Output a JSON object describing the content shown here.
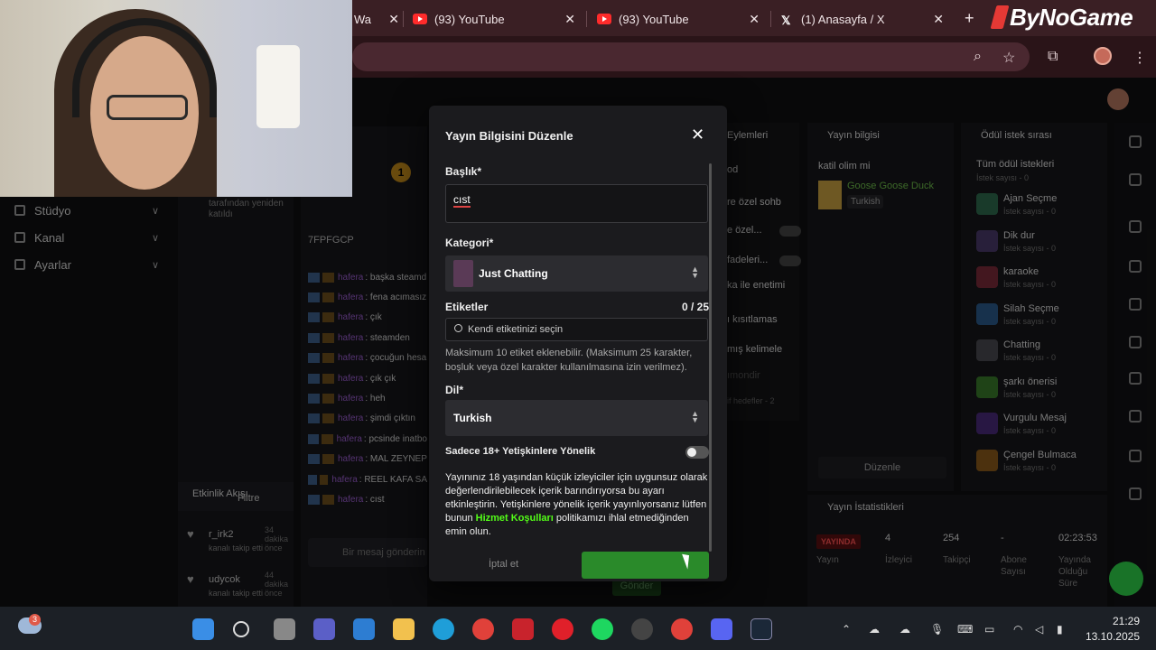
{
  "browser": {
    "tabs": [
      {
        "label": "Wa",
        "type": "partial"
      },
      {
        "label": "(93) YouTube",
        "type": "youtube"
      },
      {
        "label": "(93) YouTube",
        "type": "youtube"
      },
      {
        "label": "(1) Anasayfa / X",
        "type": "x"
      }
    ],
    "brand": "ByNoGame"
  },
  "leftnav": {
    "items": [
      {
        "label": "Stüdyo",
        "icon": "studio-icon"
      },
      {
        "label": "Kanal",
        "icon": "channel-icon"
      },
      {
        "label": "Ayarlar",
        "icon": "gear-icon"
      }
    ]
  },
  "activity": {
    "header": "Etkinlik Akışı",
    "filter": "Filtre",
    "top_text": "tarafından yeniden katıldı",
    "follows": [
      {
        "name": "r_irk2",
        "ago": "34 dakika önce",
        "sub": "kanalı takip etti"
      },
      {
        "name": "udycok",
        "ago": "44 dakika önce",
        "sub": "kanalı takip etti"
      }
    ]
  },
  "chat": {
    "badge": "1",
    "code": "7FPFGCP",
    "lines": [
      {
        "user": "hafera",
        "msg": "başka steamd"
      },
      {
        "user": "hafera",
        "msg": "fena acımasız"
      },
      {
        "user": "hafera",
        "msg": "çık"
      },
      {
        "user": "hafera",
        "msg": "steamden"
      },
      {
        "user": "hafera",
        "msg": "çocuğun hesa"
      },
      {
        "user": "hafera",
        "msg": "çık çık"
      },
      {
        "user": "hafera",
        "msg": "heh"
      },
      {
        "user": "hafera",
        "msg": "şimdi çıktın"
      },
      {
        "user": "hafera",
        "msg": "pcsinde inatbo"
      },
      {
        "user": "hafera",
        "msg": "MAL ZEYNEP"
      },
      {
        "user": "hafera",
        "msg": "REEL KAFA SA"
      },
      {
        "user": "hafera",
        "msg": "cıst"
      }
    ],
    "input_placeholder": "Bir mesaj gönderin",
    "send": "Gönder"
  },
  "mod": {
    "title": "Eylemleri",
    "items": [
      "od",
      "re özel sohb",
      "e özel...",
      "fadeleri...",
      "ka ile enetimi",
      "ı kısıtlamas",
      "mış kelimele",
      "ımondir",
      "if hedefler - 2"
    ]
  },
  "stream_info": {
    "title": "Yayın bilgisi",
    "stream_title": "katil olim mi",
    "game": "Goose Goose Duck",
    "language": "Turkish",
    "edit": "Düzenle"
  },
  "rewards": {
    "title": "Ödül istek sırası",
    "all": "Tüm ödül istekleri",
    "all_sub": "İstek sayısı - 0",
    "items": [
      {
        "name": "Ajan Seçme",
        "count": "İstek sayısı - 0",
        "color": "#2e6b4e"
      },
      {
        "name": "Dik dur",
        "count": "İstek sayısı - 0",
        "color": "#4a3a6a"
      },
      {
        "name": "karaoke",
        "count": "İstek sayısı - 0",
        "color": "#7a2a3a"
      },
      {
        "name": "Silah Seçme",
        "count": "İstek sayısı - 0",
        "color": "#2a5a8a"
      },
      {
        "name": "Chatting",
        "count": "İstek sayısı - 0",
        "color": "#4a4a50"
      },
      {
        "name": "şarkı önerisi",
        "count": "İstek sayısı - 0",
        "color": "#3a7a2a"
      },
      {
        "name": "Vurgulu Mesaj",
        "count": "İstek sayısı - 0",
        "color": "#4a2a7a"
      },
      {
        "name": "Çengel Bulmaca",
        "count": "İstek sayısı - 0",
        "color": "#8a5a1a"
      }
    ]
  },
  "stats": {
    "title": "Yayın İstatistikleri",
    "live": "YAYINDA",
    "live_label": "Yayın",
    "viewers": "4",
    "viewers_label": "İzleyici",
    "followers": "254",
    "followers_label": "Takipçi",
    "subs": "-",
    "subs_label": "Abone Sayısı",
    "uptime": "02:23:53",
    "uptime_label": "Yayında Olduğu Süre"
  },
  "modal": {
    "title": "Yayın Bilgisini Düzenle",
    "title_label": "Başlık*",
    "title_value": "cıst",
    "category_label": "Kategori*",
    "category_value": "Just Chatting",
    "tags_label": "Etiketler",
    "tags_count": "0 / 25",
    "tags_placeholder": "Kendi etiketinizi seçin",
    "tags_help": "Maksimum 10 etiket eklenebilir. (Maksimum 25 karakter, boşluk veya özel karakter kullanılmasına izin verilmez).",
    "lang_label": "Dil*",
    "lang_value": "Turkish",
    "adult_label": "Sadece 18+ Yetişkinlere Yönelik",
    "adult_on": false,
    "warn_pre": "Yayınınız 18 yaşından küçük izleyiciler için uygunsuz olarak değerlendirilebilecek içerik barındırıyorsa bu ayarı etkinleştirin. Yetişkinlere yönelik içerik yayınlıyorsanız lütfen bunun",
    "warn_link": "Hizmet Koşulları",
    "warn_post": "politikamızı ihlal etmediğinden emin olun.",
    "cancel": "İptal et"
  },
  "taskbar": {
    "weather_badge": "3",
    "time": "21:29",
    "date": "13.10.2025"
  }
}
